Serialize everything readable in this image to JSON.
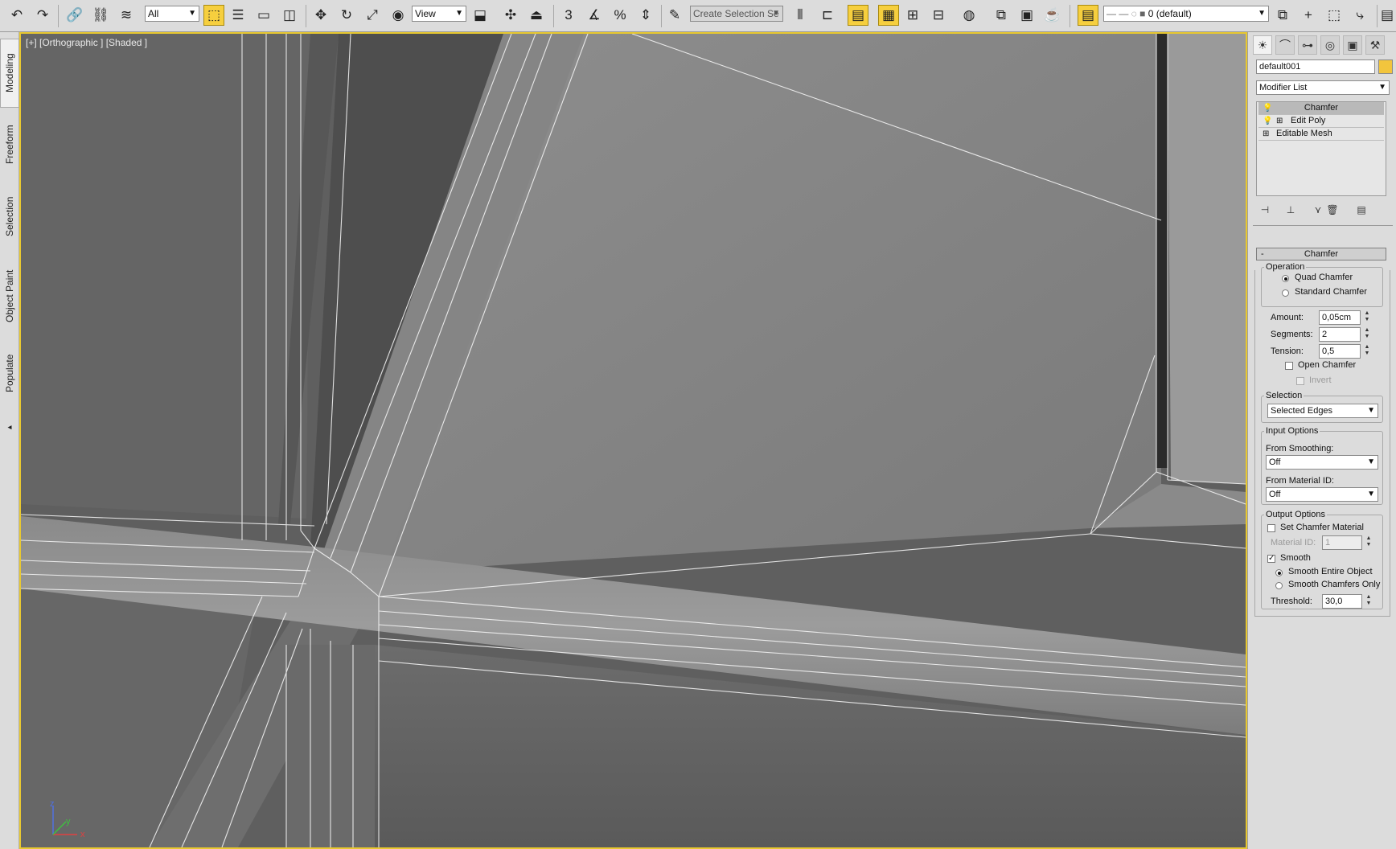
{
  "toolbar": {
    "filter_value": "All",
    "refcoord_value": "View",
    "selection_set_placeholder": "Create Selection Se",
    "snap_label": "3",
    "layer_value": "0 (default)"
  },
  "left_tabs": [
    "Modeling",
    "Freeform",
    "Selection",
    "Object Paint",
    "Populate"
  ],
  "viewport": {
    "label": "[+] [Orthographic ] [Shaded ]",
    "axis_x": "x",
    "axis_y": "y",
    "axis_z": "z"
  },
  "command_panel": {
    "object_name": "default001",
    "object_color": "#f2c53d",
    "modifier_list": "Modifier List",
    "stack": [
      {
        "label": "Chamfer"
      },
      {
        "label": "Edit Poly"
      },
      {
        "label": "Editable Mesh"
      }
    ],
    "rollout": {
      "title": "Chamfer",
      "collapse_symbol": "-",
      "operation_label": "Operation",
      "operation_options": [
        "Quad Chamfer",
        "Standard Chamfer"
      ],
      "amount_label": "Amount:",
      "amount_value": "0,05cm",
      "segments_label": "Segments:",
      "segments_value": "2",
      "tension_label": "Tension:",
      "tension_value": "0,5",
      "open_chamfer_label": "Open Chamfer",
      "invert_label": "Invert",
      "selection_label": "Selection",
      "selection_value": "Selected Edges",
      "input_options_label": "Input Options",
      "from_smoothing_label": "From Smoothing:",
      "from_smoothing_value": "Off",
      "from_material_label": "From Material ID:",
      "from_material_value": "Off",
      "output_options_label": "Output Options",
      "set_chamfer_material_label": "Set Chamfer Material",
      "material_id_label": "Material ID:",
      "material_id_value": "1",
      "smooth_label": "Smooth",
      "smooth_options": [
        "Smooth Entire Object",
        "Smooth Chamfers Only"
      ],
      "threshold_label": "Threshold:",
      "threshold_value": "30,0"
    }
  }
}
